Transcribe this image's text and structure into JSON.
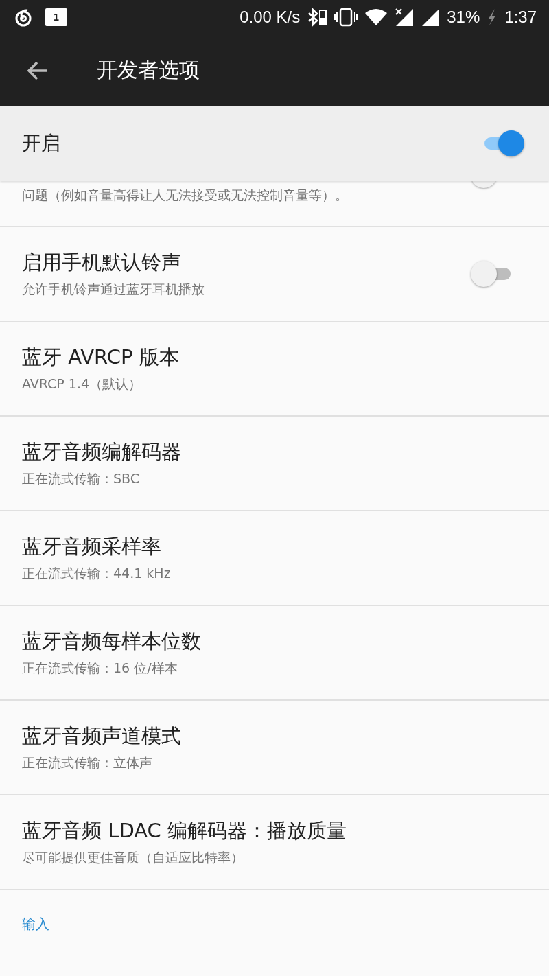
{
  "status_bar": {
    "notification_count": "1",
    "net_speed": "0.00 K/s",
    "battery": "31%",
    "time": "1:37"
  },
  "app_bar": {
    "title": "开发者选项"
  },
  "master_switch": {
    "label": "开启",
    "on": true
  },
  "partial_row": {
    "summary": "问题（例如音量高得让人无法接受或无法控制音量等）。",
    "on": false
  },
  "settings": [
    {
      "kind": "switch",
      "title": "启用手机默认铃声",
      "summary": "允许手机铃声通过蓝牙耳机播放",
      "on": false
    },
    {
      "kind": "list",
      "title": "蓝牙 AVRCP 版本",
      "summary": "AVRCP 1.4（默认）"
    },
    {
      "kind": "list",
      "title": "蓝牙音频编解码器",
      "summary": "正在流式传输：SBC"
    },
    {
      "kind": "list",
      "title": "蓝牙音频采样率",
      "summary": "正在流式传输：44.1 kHz"
    },
    {
      "kind": "list",
      "title": "蓝牙音频每样本位数",
      "summary": "正在流式传输：16 位/样本"
    },
    {
      "kind": "list",
      "title": "蓝牙音频声道模式",
      "summary": "正在流式传输：立体声"
    },
    {
      "kind": "list",
      "title": "蓝牙音频 LDAC 编解码器：播放质量",
      "summary": "尽可能提供更佳音质（自适应比特率）"
    }
  ],
  "category": {
    "title": "输入"
  }
}
